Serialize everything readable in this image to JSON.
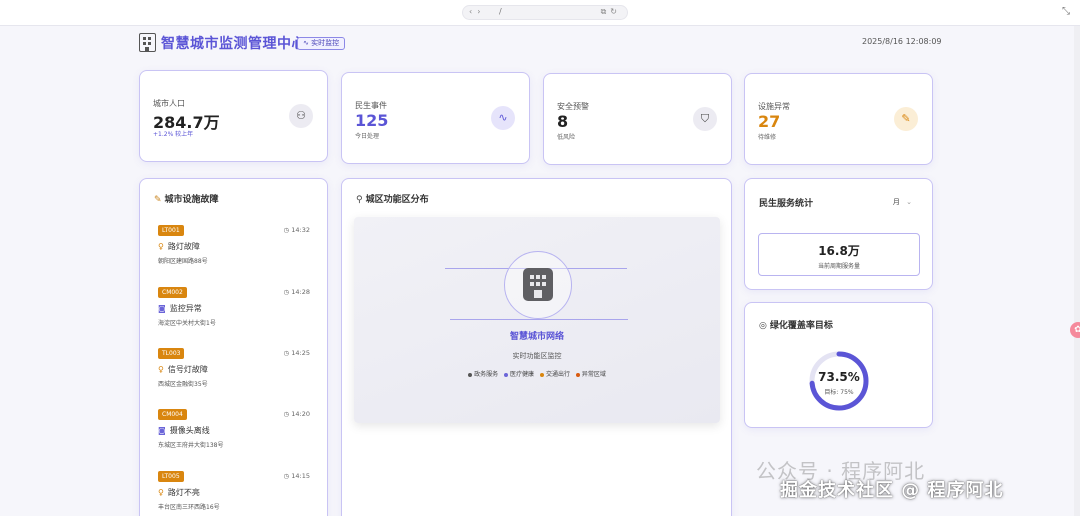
{
  "browser": {
    "url": "/"
  },
  "header": {
    "title": "智慧城市监测管理中心",
    "badge": "实时监控",
    "datetime": "2025/8/16 12:08:09"
  },
  "stats": [
    {
      "label": "城市人口",
      "value": "284.7万",
      "sub": "+1.2% 较上年",
      "icon": "users-icon"
    },
    {
      "label": "民生事件",
      "value": "125",
      "sub": "今日处理",
      "icon": "activity-icon",
      "color": "#5b55d6"
    },
    {
      "label": "安全预警",
      "value": "8",
      "sub": "低风险",
      "icon": "shield-icon"
    },
    {
      "label": "设施异常",
      "value": "27",
      "sub": "待维修",
      "icon": "wrench-icon",
      "color": "#d9860f"
    }
  ],
  "faults": {
    "title": "城市设施故障",
    "items": [
      {
        "code": "LT001",
        "time": "14:32",
        "name": "路灯故障",
        "address": "朝阳区建国路88号",
        "type": "light"
      },
      {
        "code": "CM002",
        "time": "14:28",
        "name": "监控异常",
        "address": "海淀区中关村大街1号",
        "type": "camera"
      },
      {
        "code": "TL003",
        "time": "14:25",
        "name": "信号灯故障",
        "address": "西城区金融街35号",
        "type": "light"
      },
      {
        "code": "CM004",
        "time": "14:20",
        "name": "摄像头离线",
        "address": "东城区王府井大街138号",
        "type": "camera"
      },
      {
        "code": "LT005",
        "time": "14:15",
        "name": "路灯不亮",
        "address": "丰台区南三环西路16号",
        "type": "light"
      }
    ]
  },
  "map": {
    "title": "城区功能区分布",
    "network_title": "智慧城市网络",
    "subtitle": "实时功能区监控",
    "legend": [
      {
        "label": "政务服务",
        "color": "#555555"
      },
      {
        "label": "医疗健康",
        "color": "#6b65d8"
      },
      {
        "label": "交通出行",
        "color": "#d9860f"
      },
      {
        "label": "异常区域",
        "color": "#d95a0f"
      }
    ]
  },
  "service": {
    "title": "民生服务统计",
    "period": "月",
    "value": "16.8万",
    "sub": "当前周期服务量"
  },
  "greening": {
    "title": "绿化覆盖率目标",
    "value": "73.5%",
    "target": "目标: 75%",
    "progress": 0.735,
    "color": "#5b55d6"
  },
  "watermark": {
    "line1": "公众号 · 程序阿北",
    "line2": "掘金技术社区 @ 程序阿北"
  }
}
